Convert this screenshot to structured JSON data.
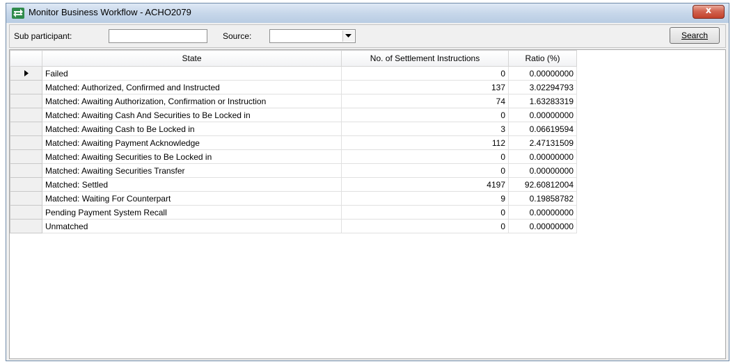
{
  "window": {
    "title": "Monitor Business Workflow - ACHO2079",
    "close_label": "x"
  },
  "toolbar": {
    "sub_participant_label": "Sub participant:",
    "sub_participant_value": "",
    "source_label": "Source:",
    "source_value": "",
    "search_label": "Search"
  },
  "table": {
    "columns": [
      "State",
      "No. of Settlement Instructions",
      "Ratio (%)"
    ],
    "rows": [
      {
        "state": "Failed",
        "count": "0",
        "ratio": "0.00000000"
      },
      {
        "state": "Matched: Authorized, Confirmed and Instructed",
        "count": "137",
        "ratio": "3.02294793"
      },
      {
        "state": "Matched: Awaiting Authorization, Confirmation or Instruction",
        "count": "74",
        "ratio": "1.63283319"
      },
      {
        "state": "Matched: Awaiting Cash And Securities to Be Locked in",
        "count": "0",
        "ratio": "0.00000000"
      },
      {
        "state": "Matched: Awaiting Cash to Be Locked in",
        "count": "3",
        "ratio": "0.06619594"
      },
      {
        "state": "Matched: Awaiting Payment Acknowledge",
        "count": "112",
        "ratio": "2.47131509"
      },
      {
        "state": "Matched: Awaiting Securities to Be Locked in",
        "count": "0",
        "ratio": "0.00000000"
      },
      {
        "state": "Matched: Awaiting Securities Transfer",
        "count": "0",
        "ratio": "0.00000000"
      },
      {
        "state": "Matched: Settled",
        "count": "4197",
        "ratio": "92.60812004"
      },
      {
        "state": "Matched: Waiting For Counterpart",
        "count": "9",
        "ratio": "0.19858782"
      },
      {
        "state": "Pending Payment System Recall",
        "count": "0",
        "ratio": "0.00000000"
      },
      {
        "state": "Unmatched",
        "count": "0",
        "ratio": "0.00000000"
      }
    ]
  },
  "icons": {
    "app": "exchange-arrows-icon",
    "row_pointer": "row-pointer-icon",
    "dropdown": "chevron-down-icon"
  },
  "colors": {
    "title_bar": "#c7d7ea",
    "close_button": "#c2412b",
    "grid_header": "#f1f2f4"
  }
}
